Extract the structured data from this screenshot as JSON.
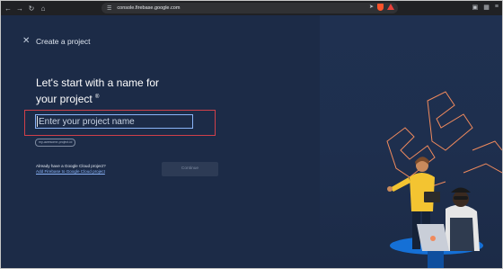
{
  "browser": {
    "url": "console.firebase.google.com",
    "nav": {
      "back_icon": "back-arrow-icon",
      "forward_icon": "forward-arrow-icon",
      "reload_icon": "reload-icon",
      "home_icon": "home-icon"
    }
  },
  "header": {
    "close_icon": "close-icon",
    "title": "Create a project"
  },
  "main": {
    "headline_line1": "Let's start with a name for",
    "headline_line2": "your project",
    "headline_mark": "®",
    "project_name_placeholder": "Enter your project name",
    "project_name_value": "",
    "project_id_chip": "my-awesome-project-id",
    "gcp_question": "Already have a Google Cloud project?",
    "gcp_link": "Add Firebase to Google Cloud project",
    "continue_label": "Continue"
  },
  "colors": {
    "background": "#1c2b47",
    "highlight": "#d0404a",
    "link": "#8ab4f8",
    "illustration_orange": "#f08a5d"
  }
}
